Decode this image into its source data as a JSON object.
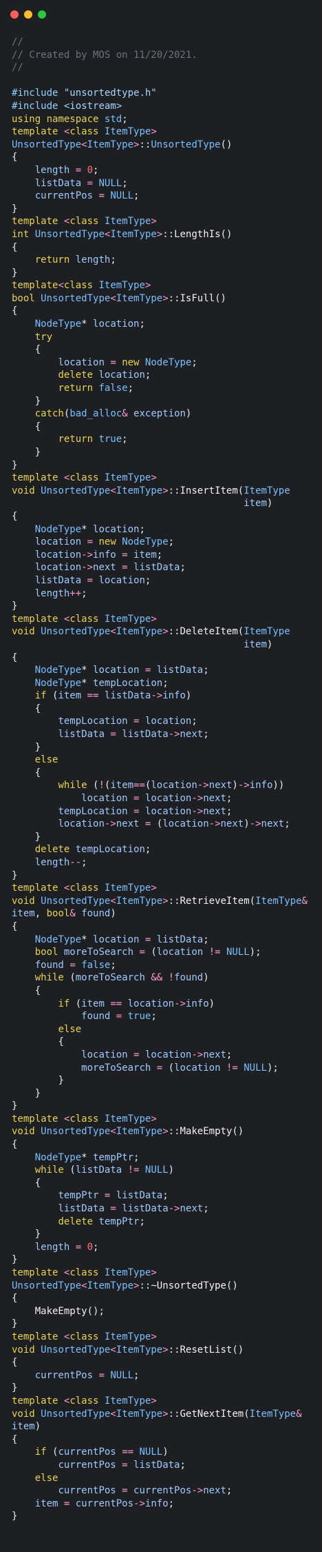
{
  "window": {
    "controls": [
      "close",
      "minimize",
      "maximize"
    ],
    "colors": {
      "close": "#ff5f57",
      "minimize": "#febc2e",
      "maximize": "#28c840",
      "background": "#1d1f23"
    }
  },
  "code_lines": [
    "//",
    "// Created by MOS on 11/20/2021.",
    "//",
    "",
    "#include \"unsortedtype.h\"",
    "#include <iostream>",
    "using namespace std;",
    "template <class ItemType>",
    "UnsortedType<ItemType>::UnsortedType()",
    "{",
    "    length = 0;",
    "    listData = NULL;",
    "    currentPos = NULL;",
    "}",
    "template <class ItemType>",
    "int UnsortedType<ItemType>::LengthIs()",
    "{",
    "    return length;",
    "}",
    "template<class ItemType>",
    "bool UnsortedType<ItemType>::IsFull()",
    "{",
    "    NodeType* location;",
    "    try",
    "    {",
    "        location = new NodeType;",
    "        delete location;",
    "        return false;",
    "    }",
    "    catch(bad_alloc& exception)",
    "    {",
    "        return true;",
    "    }",
    "}",
    "template <class ItemType>",
    "void UnsortedType<ItemType>::InsertItem(ItemType",
    "                                        item)",
    "{",
    "    NodeType* location;",
    "    location = new NodeType;",
    "    location->info = item;",
    "    location->next = listData;",
    "    listData = location;",
    "    length++;",
    "}",
    "template <class ItemType>",
    "void UnsortedType<ItemType>::DeleteItem(ItemType",
    "                                        item)",
    "{",
    "    NodeType* location = listData;",
    "    NodeType* tempLocation;",
    "    if (item == listData->info)",
    "    {",
    "        tempLocation = location;",
    "        listData = listData->next;",
    "    }",
    "    else",
    "    {",
    "        while (!(item==(location->next)->info))",
    "            location = location->next;",
    "        tempLocation = location->next;",
    "        location->next = (location->next)->next;",
    "    }",
    "    delete tempLocation;",
    "    length--;",
    "}",
    "template <class ItemType>",
    "void UnsortedType<ItemType>::RetrieveItem(ItemType&",
    "item, bool& found)",
    "{",
    "    NodeType* location = listData;",
    "    bool moreToSearch = (location != NULL);",
    "    found = false;",
    "    while (moreToSearch && !found)",
    "    {",
    "        if (item == location->info)",
    "            found = true;",
    "        else",
    "        {",
    "            location = location->next;",
    "            moreToSearch = (location != NULL);",
    "        }",
    "    }",
    "}",
    "template <class ItemType>",
    "void UnsortedType<ItemType>::MakeEmpty()",
    "{",
    "    NodeType* tempPtr;",
    "    while (listData != NULL)",
    "    {",
    "        tempPtr = listData;",
    "        listData = listData->next;",
    "        delete tempPtr;",
    "    }",
    "    length = 0;",
    "}",
    "template <class ItemType>",
    "UnsortedType<ItemType>::~UnsortedType()",
    "{",
    "    MakeEmpty();",
    "}",
    "template <class ItemType>",
    "void UnsortedType<ItemType>::ResetList()",
    "{",
    "    currentPos = NULL;",
    "}",
    "template <class ItemType>",
    "void UnsortedType<ItemType>::GetNextItem(ItemType&",
    "item)",
    "{",
    "    if (currentPos == NULL)",
    "        currentPos = listData;",
    "    else",
    "        currentPos = currentPos->next;",
    "    item = currentPos->info;",
    "}"
  ]
}
